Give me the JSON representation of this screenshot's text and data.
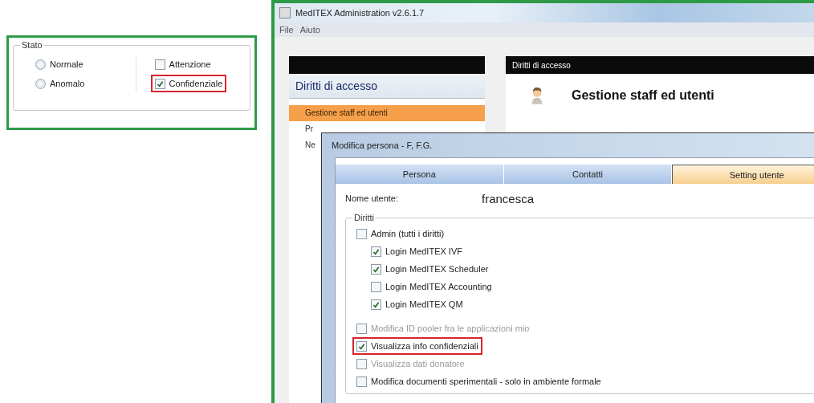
{
  "stato_panel": {
    "title": "Stato",
    "options": [
      {
        "kind": "radio",
        "label": "Normale",
        "checked": false,
        "highlighted": false
      },
      {
        "kind": "radio",
        "label": "Anomalo",
        "checked": false,
        "highlighted": false
      },
      {
        "kind": "checkbox",
        "label": "Attenzione",
        "checked": false,
        "highlighted": false
      },
      {
        "kind": "checkbox",
        "label": "Confidenziale",
        "checked": true,
        "highlighted": true
      }
    ]
  },
  "window": {
    "title": "MedITEX Administration v2.6.1.7",
    "menu": [
      "File",
      "Aiuto"
    ],
    "nav": {
      "title": "Diritti di accesso",
      "items": [
        {
          "label": "Gestione staff ed utenti",
          "selected": true
        },
        {
          "label": "Pr",
          "selected": false
        },
        {
          "label": "Ne",
          "selected": false
        }
      ]
    },
    "content": {
      "header": "Diritti di accesso",
      "title": "Gestione staff ed utenti"
    }
  },
  "dialog": {
    "title": "Modifica persona - F, F.G.",
    "tabs": [
      {
        "label": "Persona",
        "selected": false
      },
      {
        "label": "Contatti",
        "selected": false
      },
      {
        "label": "Setting utente",
        "selected": true
      }
    ],
    "username_label": "Nome utente:",
    "username": "francesca",
    "rights": {
      "title": "Diritti",
      "items": [
        {
          "label": "Admin (tutti i diritti)",
          "checked": false,
          "disabled": false,
          "highlighted": false,
          "children": [
            {
              "label": "Login MedITEX IVF",
              "checked": true,
              "disabled": false,
              "highlighted": false
            },
            {
              "label": "Login MedITEX Scheduler",
              "checked": true,
              "disabled": false,
              "highlighted": false
            },
            {
              "label": "Login MedITEX Accounting",
              "checked": false,
              "disabled": false,
              "highlighted": false
            },
            {
              "label": "Login MedITEX QM",
              "checked": true,
              "disabled": false,
              "highlighted": false
            }
          ]
        },
        {
          "label": "Modifica ID pooler fra le applicazioni mio",
          "checked": false,
          "disabled": true,
          "highlighted": false
        },
        {
          "label": "Visualizza info confidenziali",
          "checked": true,
          "disabled": false,
          "highlighted": true
        },
        {
          "label": "Visualizza dati donatore",
          "checked": false,
          "disabled": true,
          "highlighted": false
        },
        {
          "label": "Modifica documenti sperimentali - solo in ambiente formale",
          "checked": false,
          "disabled": false,
          "highlighted": false
        }
      ]
    }
  }
}
